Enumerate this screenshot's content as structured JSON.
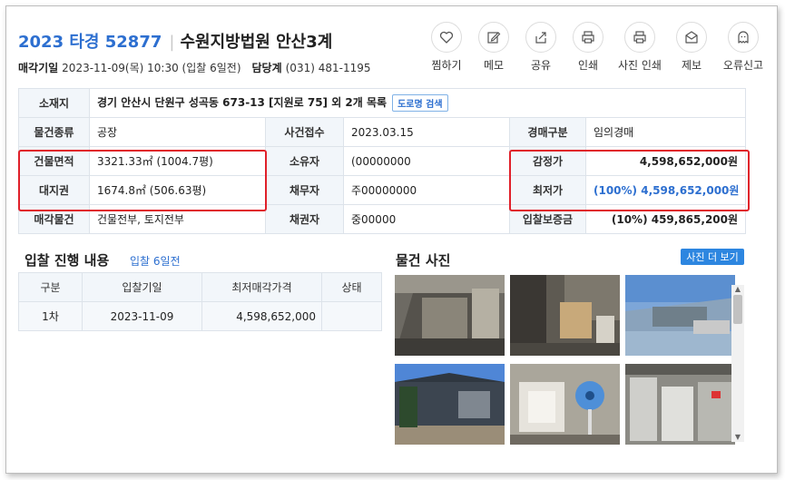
{
  "header": {
    "case_number": "2023 타경 52877",
    "court": "수원지방법원 안산3계",
    "auction_date_label": "매각기일",
    "auction_date_value": "2023-11-09(목) 10:30 (입찰 6일전)",
    "department_label": "담당계",
    "department_phone": "(031) 481-1195"
  },
  "actions": [
    {
      "label": "찜하기",
      "icon": "heart-icon"
    },
    {
      "label": "메모",
      "icon": "pencil-icon"
    },
    {
      "label": "공유",
      "icon": "share-icon"
    },
    {
      "label": "인쇄",
      "icon": "printer-icon"
    },
    {
      "label": "사진 인쇄",
      "icon": "printer-icon"
    },
    {
      "label": "제보",
      "icon": "envelope-icon"
    },
    {
      "label": "오류신고",
      "icon": "ghost-icon"
    }
  ],
  "info": {
    "location_label": "소재지",
    "location_value": "경기 안산시 단원구 성곡동 673-13 [지원로 75] 외 2개 목록",
    "road_search": "도로명 검색",
    "type_label": "물건종류",
    "type_value": "공장",
    "received_label": "사건접수",
    "received_value": "2023.03.15",
    "auction_kind_label": "경매구분",
    "auction_kind_value": "임의경매",
    "building_area_label": "건물면적",
    "building_area_value": "3321.33㎡ (1004.7평)",
    "owner_label": "소유자",
    "owner_value": "(00000000",
    "appraisal_label": "감정가",
    "appraisal_value": "4,598,652,000원",
    "land_right_label": "대지권",
    "land_right_value": "1674.8㎡ (506.63평)",
    "debtor_label": "채무자",
    "debtor_value": "주00000000",
    "min_price_label": "최저가",
    "min_price_value": "(100%) 4,598,652,000원",
    "sale_item_label": "매각물건",
    "sale_item_value": "건물전부, 토지전부",
    "creditor_label": "채권자",
    "creditor_value": "중00000",
    "deposit_label": "입찰보증금",
    "deposit_value": "(10%) 459,865,200원"
  },
  "bidding": {
    "title": "입찰 진행 내용",
    "subtitle": "입찰 6일전",
    "columns": [
      "구분",
      "입찰기일",
      "최저매각가격",
      "상태"
    ],
    "rows": [
      {
        "round": "1차",
        "date": "2023-11-09",
        "price": "4,598,652,000",
        "status": ""
      }
    ]
  },
  "photos": {
    "title": "물건 사진",
    "more_button": "사진 더 보기",
    "count": 6
  }
}
